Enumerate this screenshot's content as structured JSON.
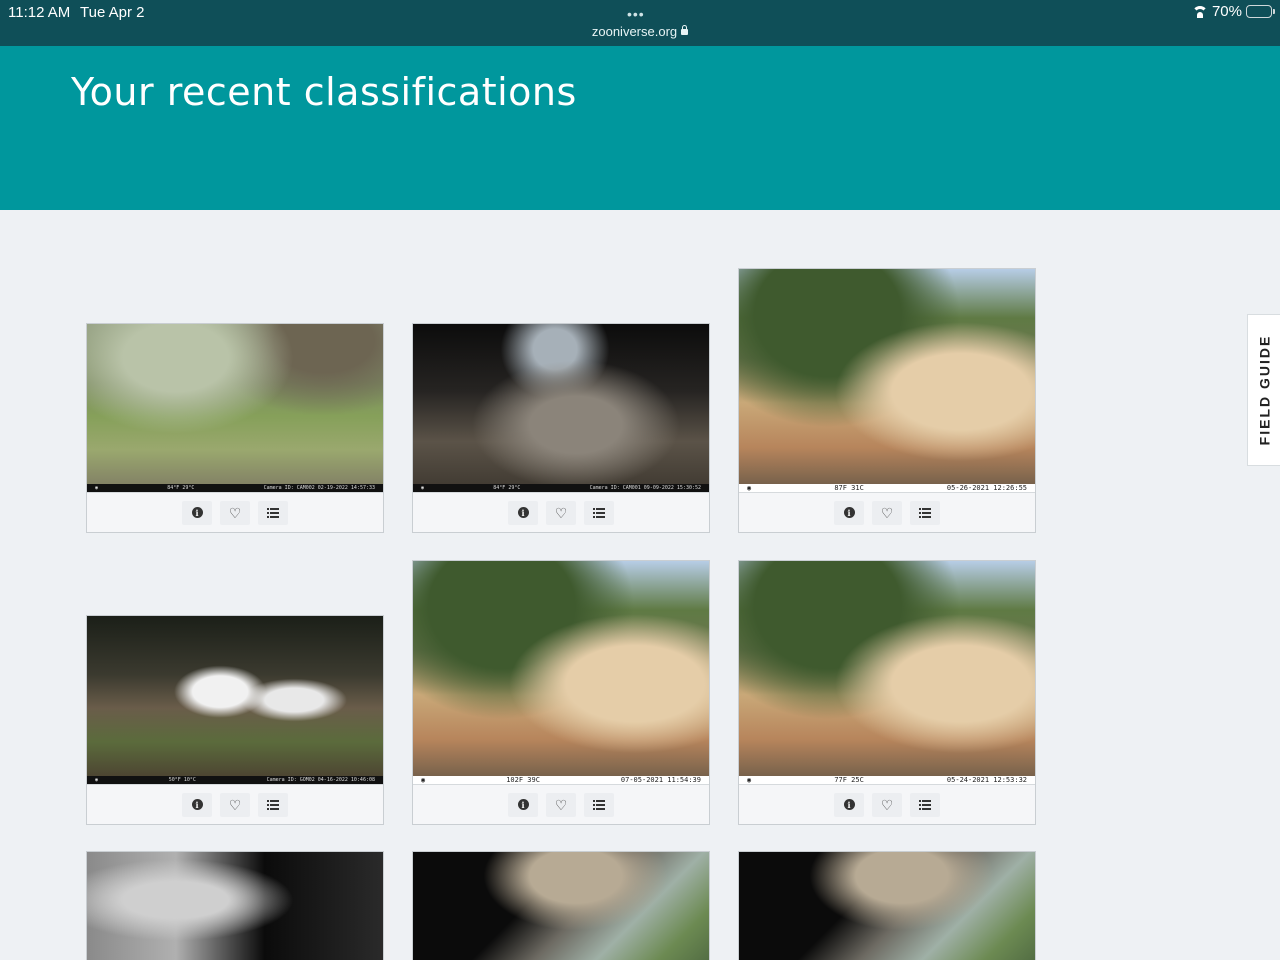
{
  "status_bar": {
    "time": "11:12 AM",
    "date": "Tue Apr 2",
    "dots": "•••",
    "url": "zooniverse.org",
    "battery": "70%",
    "battery_level": 0.7,
    "icons": [
      "wifi-icon",
      "battery-icon",
      "lock-icon"
    ]
  },
  "header": {
    "title": "Your recent classifications"
  },
  "field_guide": {
    "label": "FIELD GUIDE"
  },
  "colors": {
    "banner": "#00979d",
    "status_bar": "#0f4f58",
    "page_bg": "#eef1f4",
    "battery_fill": "#f5d000"
  },
  "classifications": [
    {
      "scene": "grassy-hillside",
      "caption_left": "",
      "caption_mid": "84°F  29°C",
      "caption_right": "Camera ID: CAM002  02-19-2022  14:57:33"
    },
    {
      "scene": "pine-needles-dark",
      "caption_left": "",
      "caption_mid": "84°F  29°C",
      "caption_right": "Camera ID: CAM001  09-09-2022  15:30:52"
    },
    {
      "scene": "rocky-shrubland",
      "caption_left": "",
      "caption_mid": "87F  31C",
      "caption_right": "05-26-2021  12:26:55"
    },
    {
      "scene": "white-boards-brush",
      "caption_left": "",
      "caption_mid": "50°F  10°C",
      "caption_right": "Camera ID: GOM02  04-16-2022  10:46:08"
    },
    {
      "scene": "rocky-shrubland",
      "caption_left": "",
      "caption_mid": "102F  39C",
      "caption_right": "07-05-2021  11:54:39"
    },
    {
      "scene": "rocky-shrubland",
      "caption_left": "",
      "caption_mid": "77F  25C",
      "caption_right": "05-24-2021  12:53:32"
    },
    {
      "scene": "night-infrared"
    },
    {
      "scene": "upside-down-valley"
    },
    {
      "scene": "upside-down-valley"
    }
  ],
  "card_actions": [
    {
      "name": "info-button",
      "icon": "info-icon"
    },
    {
      "name": "favorite-button",
      "icon": "heart-icon"
    },
    {
      "name": "collections-button",
      "icon": "list-icon"
    }
  ]
}
